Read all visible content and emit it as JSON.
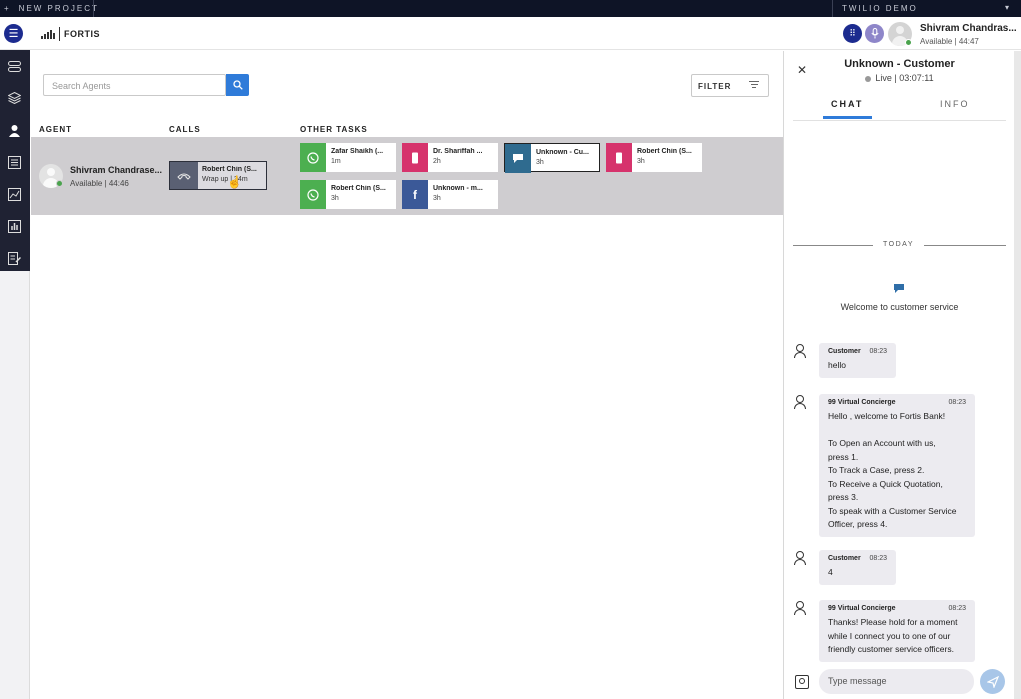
{
  "topbar": {
    "new_project_icon": "+",
    "new_project_label": "NEW PROJECT",
    "demo_label": "TWILIO DEMO",
    "demo_caret": "▾"
  },
  "header": {
    "logo_text": "FORTIS",
    "user_name": "Shivram Chandras...",
    "user_status": "Available | 44:47"
  },
  "sidenav": {
    "icons": [
      "tasks-icon",
      "layers-icon",
      "agents-icon",
      "list-icon",
      "chart-icon",
      "reports-icon",
      "notes-icon"
    ]
  },
  "main": {
    "search_placeholder": "Search Agents",
    "filter_label": "FILTER",
    "columns": {
      "agent": "AGENT",
      "calls": "CALLS",
      "other_tasks": "OTHER TASKS"
    },
    "agent": {
      "name": "Shivram Chandrase...",
      "status": "Available | 44:46"
    },
    "call": {
      "name": "Robert Chin (S...",
      "status": "Wrap up | 34m"
    },
    "tasks": [
      {
        "name": "Zafar Shaikh (...",
        "time": "1m",
        "channel": "whatsapp",
        "color": "#4caf50"
      },
      {
        "name": "Dr. Shariffah ...",
        "time": "2h",
        "channel": "sms",
        "color": "#d6336c"
      },
      {
        "name": "Unknown - Cu...",
        "time": "3h",
        "channel": "chat",
        "color": "#2f6b8f"
      },
      {
        "name": "Robert Chin (S...",
        "time": "3h",
        "channel": "sms",
        "color": "#d6336c"
      },
      {
        "name": "Robert Chin (S...",
        "time": "3h",
        "channel": "whatsapp",
        "color": "#4caf50"
      },
      {
        "name": "Unknown - m...",
        "time": "3h",
        "channel": "facebook",
        "color": "#3b5998"
      }
    ]
  },
  "panel": {
    "title": "Unknown - Customer",
    "status": "Live | 03:07:11",
    "tabs": {
      "chat": "CHAT",
      "info": "INFO"
    },
    "today": "TODAY",
    "welcome": "Welcome to customer service",
    "messages": [
      {
        "sender": "Customer",
        "time": "08:23",
        "text": "hello"
      },
      {
        "sender": "99 Virtual Concierge",
        "time": "08:23",
        "text": "Hello , welcome to Fortis Bank!\n\nTo Open an Account with us,\npress 1.\nTo Track a Case, press 2.\nTo Receive a Quick Quotation,\npress 3.\nTo speak with a Customer Service\nOfficer, press 4."
      },
      {
        "sender": "Customer",
        "time": "08:23",
        "text": "4"
      },
      {
        "sender": "99 Virtual Concierge",
        "time": "08:23",
        "text": "Thanks! Please hold for a moment\nwhile I connect you to one of our\nfriendly customer service officers."
      }
    ],
    "input_placeholder": "Type message"
  }
}
